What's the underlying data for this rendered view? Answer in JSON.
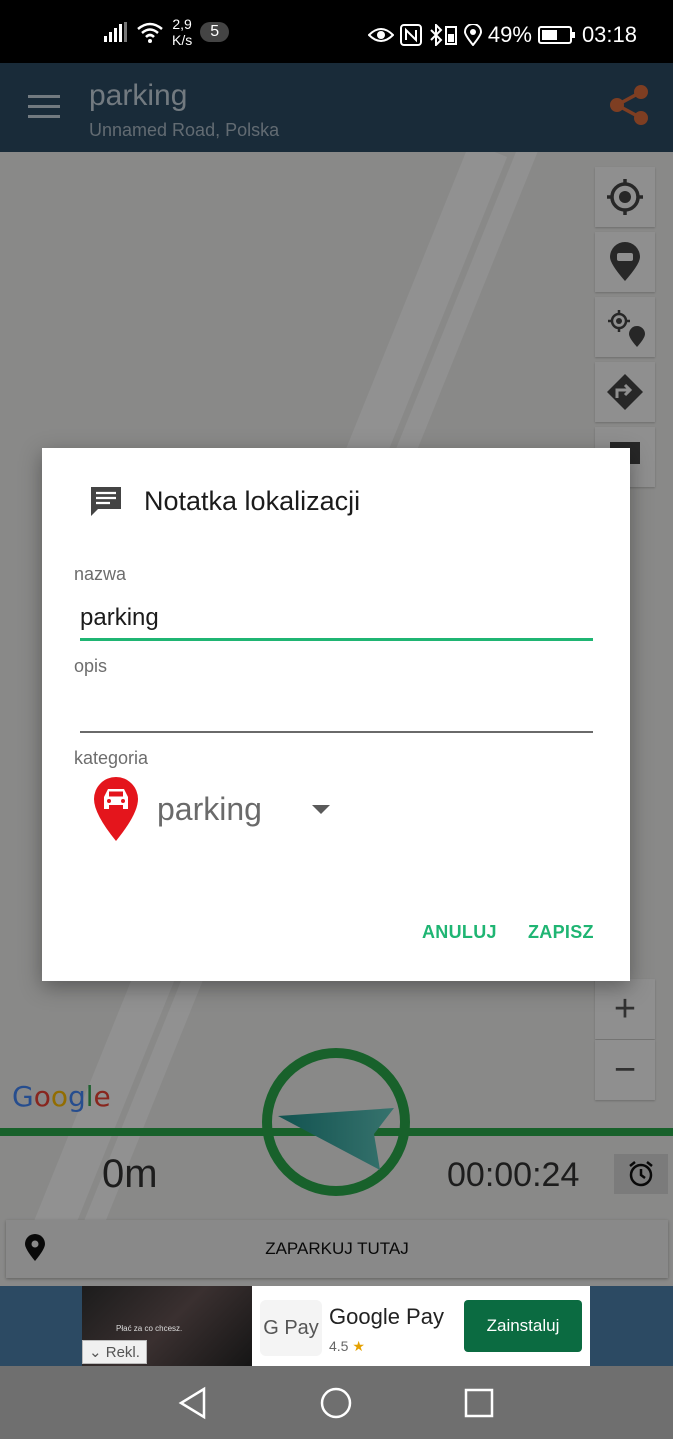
{
  "status_bar": {
    "net_speed_value": "2,9",
    "net_speed_unit": "K/s",
    "notification_count": "5",
    "battery_percent": "49%",
    "time": "03:18"
  },
  "app_bar": {
    "title": "parking",
    "subtitle": "Unnamed Road, Polska",
    "icons": [
      "menu-icon",
      "share-icon"
    ]
  },
  "map": {
    "google_label": [
      "G",
      "o",
      "o",
      "g",
      "l",
      "e"
    ],
    "controls": [
      "my-location-icon",
      "car-marker-icon",
      "location-to-car-icon",
      "directions-icon",
      "note-icon",
      "zoom-in-icon",
      "zoom-out-icon"
    ],
    "zoom_in_label": "+",
    "zoom_out_label": "−"
  },
  "tracker": {
    "distance": "0m",
    "elapsed": "00:00:24"
  },
  "park_here": {
    "label": "ZAPARKUJ TUTAJ"
  },
  "ad": {
    "thumb_text": "Płać za co chcesz.",
    "badge": "Rekl.",
    "logo_text": "G Pay",
    "app_name": "Google Pay",
    "rating": "4.5",
    "install_label": "Zainstaluj"
  },
  "dialog": {
    "title": "Notatka lokalizacji",
    "name_label": "nazwa",
    "name_value": "parking",
    "desc_label": "opis",
    "desc_value": "",
    "category_label": "kategoria",
    "category_value": "parking",
    "cancel_label": "ANULUJ",
    "save_label": "ZAPISZ"
  },
  "colors": {
    "app_bar": "#2c4a63",
    "accent_green": "#1fb573",
    "tracker_green": "#2aa84a",
    "pin_red": "#e4151c"
  }
}
